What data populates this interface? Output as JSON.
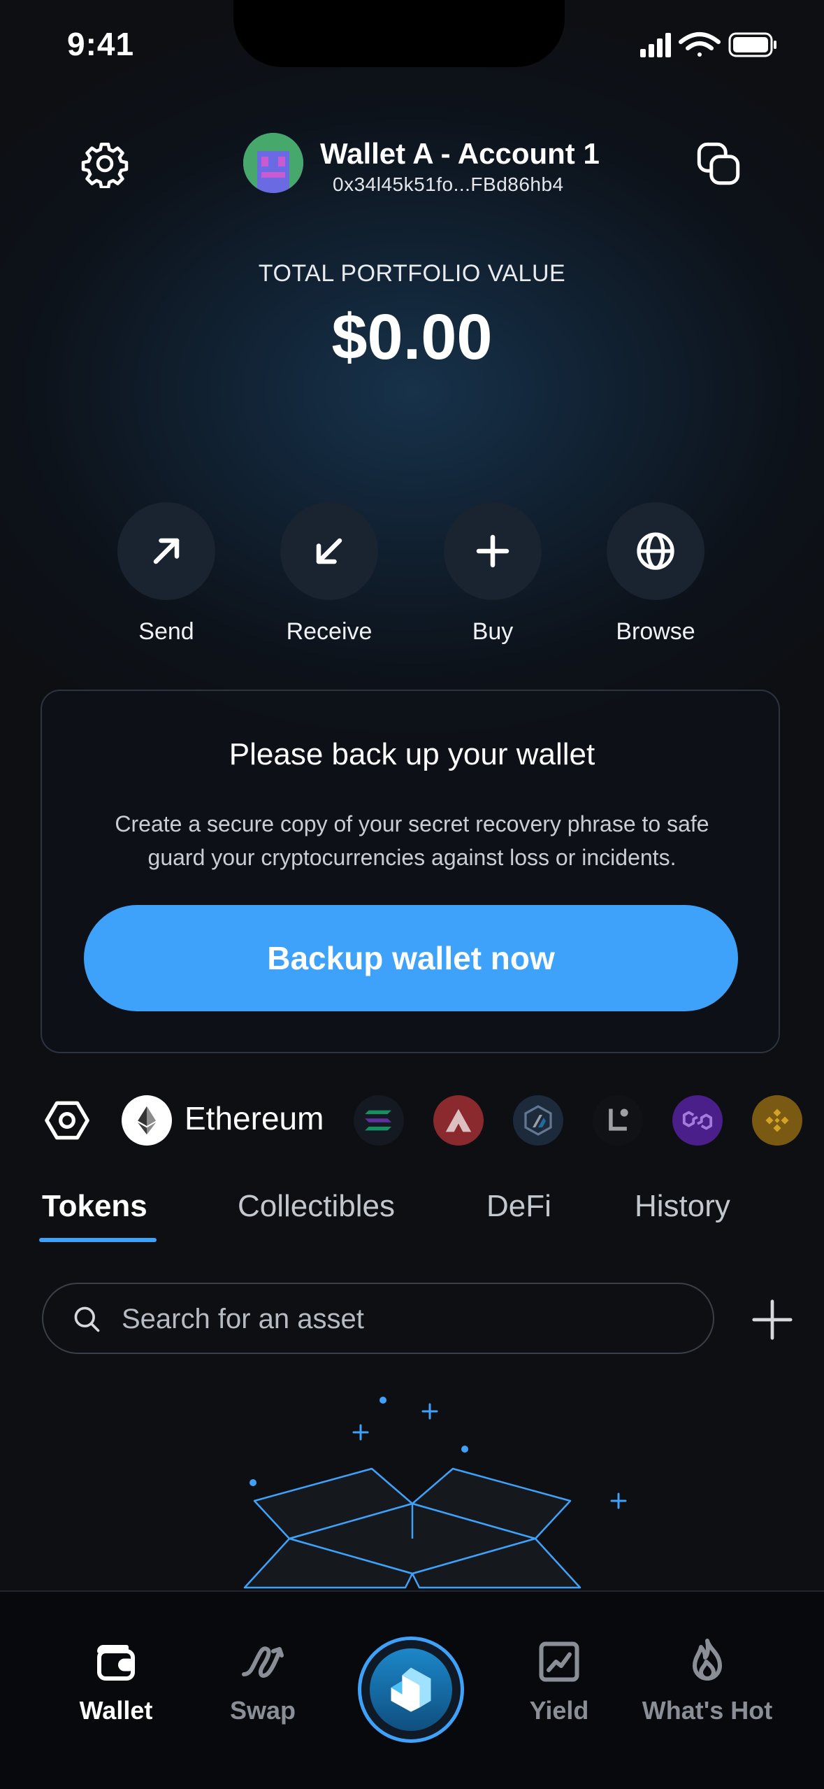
{
  "status_bar": {
    "time": "9:41"
  },
  "header": {
    "account_name": "Wallet A - Account 1",
    "account_address": "0x34l45k51fo...FBd86hb4"
  },
  "portfolio": {
    "label": "TOTAL PORTFOLIO VALUE",
    "value": "$0.00"
  },
  "actions": [
    {
      "label": "Send",
      "icon": "arrow-up-right-icon"
    },
    {
      "label": "Receive",
      "icon": "arrow-down-left-icon"
    },
    {
      "label": "Buy",
      "icon": "plus-icon"
    },
    {
      "label": "Browse",
      "icon": "globe-icon"
    }
  ],
  "backup_card": {
    "title": "Please back up your wallet",
    "description": "Create a secure copy of your secret recovery phrase to safe guard your cryptocurrencies against loss or incidents.",
    "button_label": "Backup wallet now"
  },
  "networks": {
    "selected": "Ethereum",
    "others": [
      "solana-icon",
      "avalanche-icon",
      "arbitrum-icon",
      "linea-icon",
      "polygon-icon",
      "bnb-icon"
    ]
  },
  "tabs": [
    {
      "label": "Tokens",
      "active": true
    },
    {
      "label": "Collectibles",
      "active": false
    },
    {
      "label": "DeFi",
      "active": false
    },
    {
      "label": "History",
      "active": false
    }
  ],
  "search": {
    "placeholder": "Search for an asset"
  },
  "bottom_nav": [
    {
      "label": "Wallet",
      "active": true
    },
    {
      "label": "Swap",
      "active": false
    },
    {
      "label": "",
      "active": false
    },
    {
      "label": "Yield",
      "active": false
    },
    {
      "label": "What's Hot",
      "active": false
    }
  ],
  "colors": {
    "accent": "#3ea2fb",
    "background": "#0d0f13",
    "action_circle": "#1a2330"
  }
}
